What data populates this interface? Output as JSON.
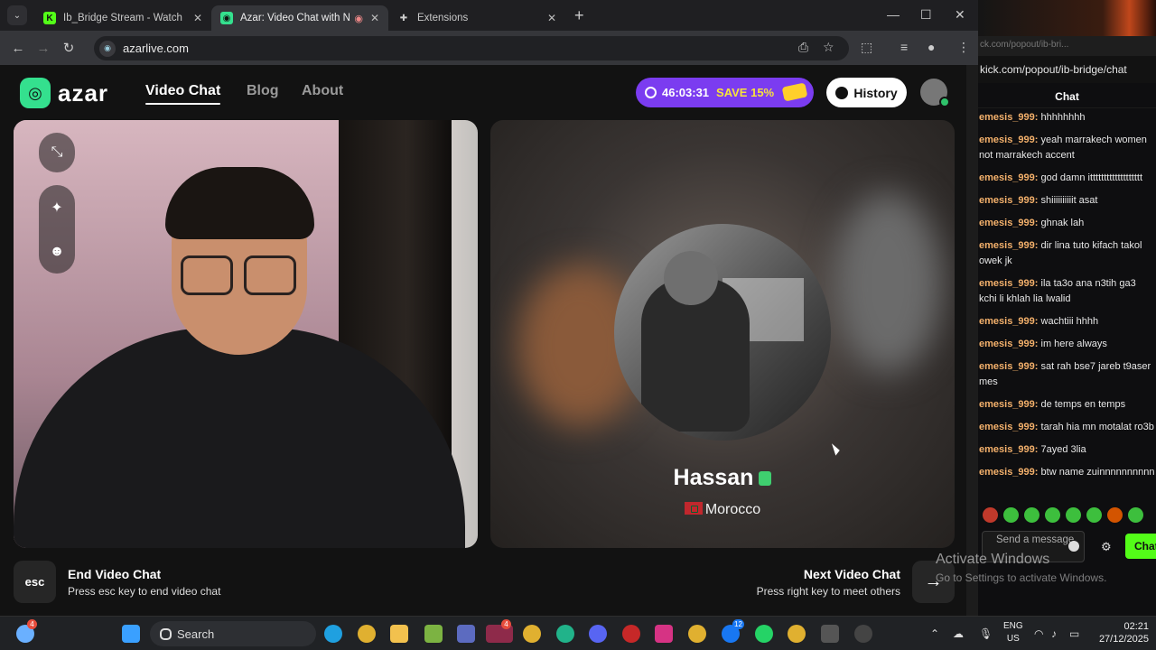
{
  "browser": {
    "tabs": [
      {
        "title": "Ib_Bridge Stream - Watch Live o",
        "favicon": "kick-icon",
        "color": "#53fc18",
        "active": false
      },
      {
        "title": "Azar: Video Chat with New F",
        "favicon": "azar-icon",
        "color": "#34e08e",
        "active": true
      },
      {
        "title": "Extensions",
        "favicon": "puzzle-icon",
        "color": "#cccccc",
        "active": false
      }
    ],
    "url": "azarlive.com"
  },
  "header": {
    "logo_text": "azar",
    "nav": [
      {
        "label": "Video Chat",
        "active": true
      },
      {
        "label": "Blog",
        "active": false
      },
      {
        "label": "About",
        "active": false
      }
    ],
    "promo": {
      "timer": "46:03:31",
      "label": "SAVE 15%"
    },
    "history_label": "History"
  },
  "peer": {
    "name": "Hassan",
    "country": "Morocco"
  },
  "controls": {
    "esc_key": "esc",
    "end_title": "End Video Chat",
    "end_desc": "Press esc key to end video chat",
    "next_title": "Next Video Chat",
    "next_desc": "Press right key to meet others",
    "next_arrow": "→"
  },
  "chat_window": {
    "url_faded": "ck.com/popout/ib-bri...",
    "url": "kick.com/popout/ib-bridge/chat",
    "title": "Chat",
    "messages": [
      {
        "user": "emesis_999:",
        "text": "hhhhhhhh"
      },
      {
        "user": "emesis_999:",
        "text": "yeah marrakech women",
        "cont": "not marrakech accent"
      },
      {
        "user": "emesis_999:",
        "text": "god damn ittttttttttttttttttt"
      },
      {
        "user": "emesis_999:",
        "text": "shiiiiiiiiiit asat"
      },
      {
        "user": "emesis_999:",
        "text": "ghnak lah"
      },
      {
        "user": "emesis_999:",
        "text": "dir lina tuto kifach takol",
        "cont": "owek jk"
      },
      {
        "user": "emesis_999:",
        "text": "ila ta3o ana n3tih ga3",
        "cont": "kchi li khlah lia lwalid"
      },
      {
        "user": "emesis_999:",
        "text": "wachtiii hhhh"
      },
      {
        "user": "emesis_999:",
        "text": "im here always"
      },
      {
        "user": "emesis_999:",
        "text": "sat rah bse7 jareb t9aser",
        "cont": "mes"
      },
      {
        "user": "emesis_999:",
        "text": "de temps en temps"
      },
      {
        "user": "emesis_999:",
        "text": "tarah hia mn motalat ro3b"
      },
      {
        "user": "emesis_999:",
        "text": "7ayed 3lia"
      },
      {
        "user": "emesis_999:",
        "text": "btw name zuinnnnnnnnnn"
      }
    ],
    "send_placeholder": "Send a message",
    "chat_button": "Chat"
  },
  "watermark": {
    "line1": "Activate Windows",
    "line2": "Go to Settings to activate Windows."
  },
  "taskbar": {
    "search_label": "Search",
    "lang": "ENG",
    "region": "US",
    "time": "02:21",
    "date": "27/12/2025",
    "badges": {
      "weather": "4",
      "zoom": "4",
      "facebook": "12"
    }
  }
}
